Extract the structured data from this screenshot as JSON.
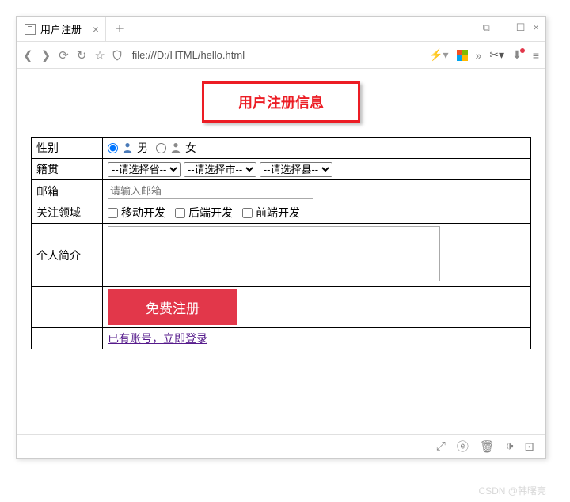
{
  "browser": {
    "tab_title": "用户注册",
    "url": "file:///D:/HTML/hello.html"
  },
  "page": {
    "heading": "用户注册信息",
    "rows": {
      "gender": {
        "label": "性别",
        "male": "男",
        "female": "女"
      },
      "origin": {
        "label": "籍贯",
        "province": "--请选择省--",
        "city": "--请选择市--",
        "county": "--请选择县--"
      },
      "email": {
        "label": "邮箱",
        "placeholder": "请输入邮箱"
      },
      "focus": {
        "label": "关注领域",
        "opt1": "移动开发",
        "opt2": "后端开发",
        "opt3": "前端开发"
      },
      "bio": {
        "label": "个人简介"
      },
      "submit": "免费注册",
      "login_link": "已有账号，立即登录"
    }
  },
  "watermark": "CSDN @韩曙亮"
}
